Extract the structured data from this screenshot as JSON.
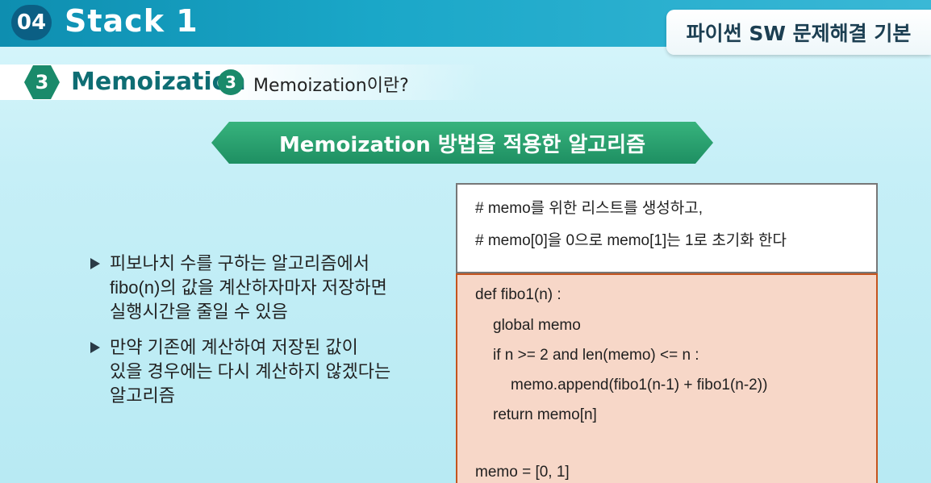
{
  "header": {
    "chapter_number": "04",
    "chapter_title": "Stack 1",
    "course_title": "파이썬 SW 문제해결 기본"
  },
  "section": {
    "number": "3",
    "title": "Memoization",
    "sub_number": "3",
    "sub_title": "Memoization이란?"
  },
  "banner": {
    "text": "Memoization 방법을 적용한 알고리즘"
  },
  "bullets": [
    "피보나치 수를 구하는 알고리즘에서\nfibo(n)의 값을 계산하자마자 저장하면\n실행시간을 줄일 수 있음",
    "만약 기존에 계산하여 저장된 값이\n있을 경우에는 다시 계산하지 않겠다는\n알고리즘"
  ],
  "code": {
    "comments": [
      "# memo를 위한 리스트를 생성하고,",
      "# memo[0]을 0으로 memo[1]는 1로 초기화 한다"
    ],
    "lines": [
      "def fibo1(n) :",
      "global memo",
      "if n >= 2 and len(memo) <= n :",
      "memo.append(fibo1(n-1) + fibo1(n-2))",
      "return memo[n]",
      "memo = [0, 1]"
    ]
  },
  "colors": {
    "header_bar": "#1aa7c8",
    "accent_green": "#1e8f62",
    "code_bg": "#f7d7c8",
    "code_border": "#c4541e"
  }
}
